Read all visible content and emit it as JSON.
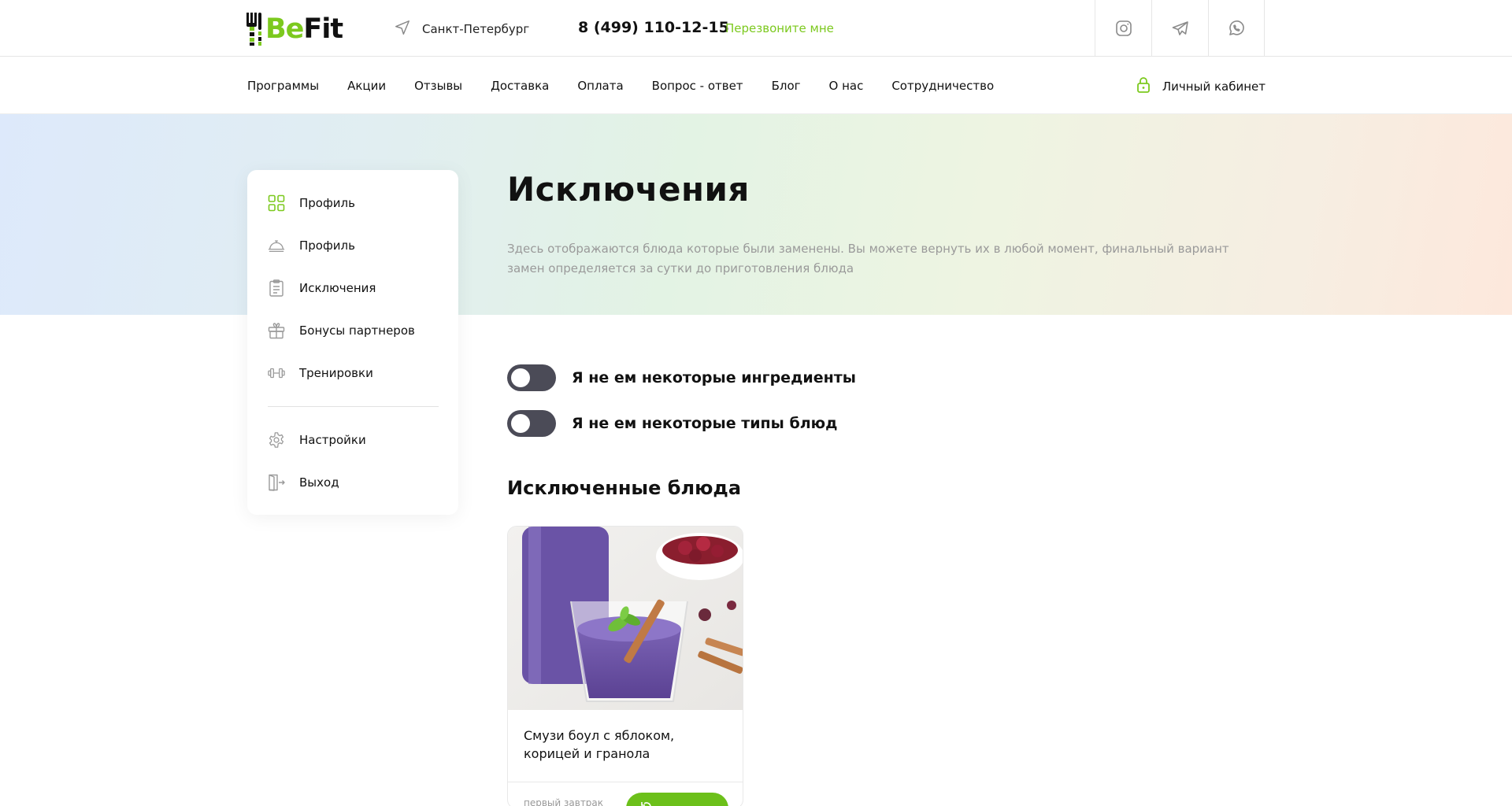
{
  "header": {
    "logo": {
      "part1": "Be",
      "part2": "Fit"
    },
    "city": "Санкт-Петербург",
    "phone": "8 (499) 110-12-15",
    "callback": "Перезвоните мне",
    "socials": [
      "instagram-icon",
      "telegram-icon",
      "whatsapp-icon"
    ]
  },
  "nav": {
    "items": [
      "Программы",
      "Акции",
      "Отзывы",
      "Доставка",
      "Оплата",
      "Вопрос - ответ",
      "Блог",
      "О нас",
      "Сотрудничество"
    ],
    "cabinet": "Личный кабинет"
  },
  "sidebar": {
    "items": [
      {
        "label": "Профиль",
        "icon": "grid-icon"
      },
      {
        "label": "Профиль",
        "icon": "cloche-icon"
      },
      {
        "label": "Исключения",
        "icon": "clipboard-icon"
      },
      {
        "label": "Бонусы партнеров",
        "icon": "gift-icon"
      },
      {
        "label": "Тренировки",
        "icon": "dumbbell-icon"
      }
    ],
    "bottom": [
      {
        "label": "Настройки",
        "icon": "gear-icon"
      },
      {
        "label": "Выход",
        "icon": "logout-icon"
      }
    ]
  },
  "main": {
    "title": "Исключения",
    "description": "Здесь отображаются блюда которые были заменены. Вы можете вернуть их в любой момент, финальный вариант замен определяется за сутки до приготовления блюда",
    "toggles": [
      {
        "label": "Я не ем некоторые ингредиенты",
        "on": false
      },
      {
        "label": "Я не ем некоторые типы блюд",
        "on": false
      }
    ],
    "section_title": "Исключенные блюда",
    "dishes": [
      {
        "name": "Смузи боул с яблоком, корицей и гранола",
        "meal": "первый завтрак"
      }
    ]
  },
  "colors": {
    "accent": "#7cc91e",
    "toggle_off": "#4b4b57",
    "muted_text": "#9a9a9a"
  }
}
